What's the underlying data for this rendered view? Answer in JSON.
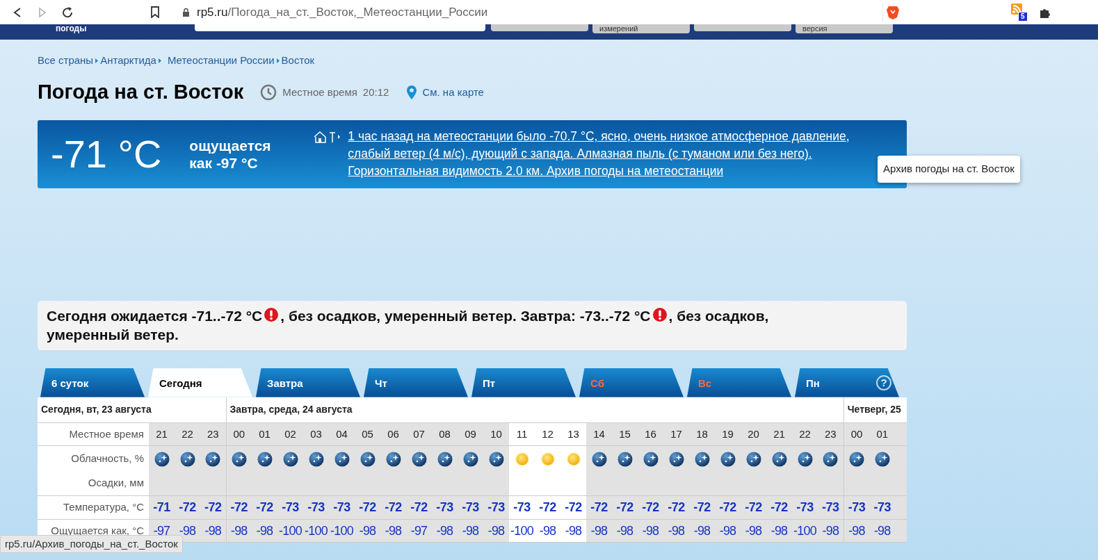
{
  "browser": {
    "url_host": "rp5.ru",
    "url_path": "/Погода_на_ст._Восток,_Метеостанции_России",
    "extension_badge": "5"
  },
  "site_header": {
    "logo_caption": "погоды",
    "buttons": [
      "измерений",
      "версия"
    ]
  },
  "breadcrumbs": [
    "Все страны",
    "Антарктида",
    "Метеостанции России",
    "Восток"
  ],
  "title": "Погода на ст. Восток",
  "local_time": {
    "label": "Местное время",
    "value": "20:12"
  },
  "map_link": "См. на карте",
  "current": {
    "temperature": "-71 °C",
    "feels_like": "ощущается как -97 °C",
    "description": "1 час назад на метеостанции было -70.7 °C, ясно, очень низкое атмосферное давление, слабый ветер (4 м/с), дующий с запада. Алмазная пыль (с туманом или без него). Горизонтальная видимость 2.0 км. Архив погоды на метеостанции",
    "tooltip": "Архив погоды на ст. Восток"
  },
  "forecast": [
    {
      "kind": "text",
      "text": "Сегодня ожидается -71..-72 °C"
    },
    {
      "kind": "alert"
    },
    {
      "kind": "text",
      "text": ", без осадков, умеренный ветер. Завтра: -73..-72 °C"
    },
    {
      "kind": "alert"
    },
    {
      "kind": "text",
      "text": ", без осадков, умеренный ветер."
    }
  ],
  "tabs": [
    {
      "label": "6 суток",
      "selected": false,
      "weekend": false
    },
    {
      "label": "Сегодня",
      "selected": true,
      "weekend": false
    },
    {
      "label": "Завтра",
      "selected": false,
      "weekend": false
    },
    {
      "label": "Чт",
      "selected": false,
      "weekend": false
    },
    {
      "label": "Пт",
      "selected": false,
      "weekend": false
    },
    {
      "label": "Сб",
      "selected": false,
      "weekend": true
    },
    {
      "label": "Вс",
      "selected": false,
      "weekend": true
    },
    {
      "label": "Пн",
      "selected": false,
      "weekend": false
    }
  ],
  "help_label": "?",
  "table": {
    "row_labels": [
      "Местное время",
      "Облачность, %",
      "Осадки, мм",
      "Температура, °C",
      "Ощущается как, °C"
    ],
    "days": [
      {
        "label": "Сегодня, вт, 23 августа",
        "hours": [
          {
            "time": "21",
            "kind": "night",
            "daylight": false,
            "temp": "-71",
            "feels": "-97"
          },
          {
            "time": "22",
            "kind": "night",
            "daylight": false,
            "temp": "-72",
            "feels": "-98"
          },
          {
            "time": "23",
            "kind": "night",
            "daylight": false,
            "temp": "-72",
            "feels": "-98"
          }
        ]
      },
      {
        "label": "Завтра, среда, 24 августа",
        "hours": [
          {
            "time": "00",
            "kind": "night",
            "daylight": false,
            "temp": "-72",
            "feels": "-98"
          },
          {
            "time": "01",
            "kind": "night",
            "daylight": false,
            "temp": "-72",
            "feels": "-98"
          },
          {
            "time": "02",
            "kind": "night",
            "daylight": false,
            "temp": "-73",
            "feels": "-100"
          },
          {
            "time": "03",
            "kind": "night",
            "daylight": false,
            "temp": "-73",
            "feels": "-100"
          },
          {
            "time": "04",
            "kind": "night",
            "daylight": false,
            "temp": "-73",
            "feels": "-100"
          },
          {
            "time": "05",
            "kind": "night",
            "daylight": false,
            "temp": "-72",
            "feels": "-98"
          },
          {
            "time": "06",
            "kind": "night",
            "daylight": false,
            "temp": "-72",
            "feels": "-98"
          },
          {
            "time": "07",
            "kind": "night",
            "daylight": false,
            "temp": "-72",
            "feels": "-97"
          },
          {
            "time": "08",
            "kind": "night",
            "daylight": false,
            "temp": "-73",
            "feels": "-98"
          },
          {
            "time": "09",
            "kind": "night",
            "daylight": false,
            "temp": "-73",
            "feels": "-98"
          },
          {
            "time": "10",
            "kind": "night",
            "daylight": false,
            "temp": "-73",
            "feels": "-98"
          },
          {
            "time": "11",
            "kind": "sun",
            "daylight": true,
            "temp": "-73",
            "feels": "-100"
          },
          {
            "time": "12",
            "kind": "sun",
            "daylight": true,
            "temp": "-72",
            "feels": "-98"
          },
          {
            "time": "13",
            "kind": "sun",
            "daylight": true,
            "temp": "-72",
            "feels": "-98"
          },
          {
            "time": "14",
            "kind": "night",
            "daylight": false,
            "temp": "-72",
            "feels": "-98"
          },
          {
            "time": "15",
            "kind": "night",
            "daylight": false,
            "temp": "-72",
            "feels": "-98"
          },
          {
            "time": "16",
            "kind": "night",
            "daylight": false,
            "temp": "-72",
            "feels": "-98"
          },
          {
            "time": "17",
            "kind": "night",
            "daylight": false,
            "temp": "-72",
            "feels": "-98"
          },
          {
            "time": "18",
            "kind": "night",
            "daylight": false,
            "temp": "-72",
            "feels": "-98"
          },
          {
            "time": "19",
            "kind": "night",
            "daylight": false,
            "temp": "-72",
            "feels": "-98"
          },
          {
            "time": "20",
            "kind": "night",
            "daylight": false,
            "temp": "-72",
            "feels": "-98"
          },
          {
            "time": "21",
            "kind": "night",
            "daylight": false,
            "temp": "-72",
            "feels": "-98"
          },
          {
            "time": "22",
            "kind": "night",
            "daylight": false,
            "temp": "-73",
            "feels": "-100"
          },
          {
            "time": "23",
            "kind": "night",
            "daylight": false,
            "temp": "-73",
            "feels": "-98"
          }
        ]
      },
      {
        "label": "Четверг, 25",
        "hours": [
          {
            "time": "00",
            "kind": "night",
            "daylight": false,
            "temp": "-73",
            "feels": "-98"
          },
          {
            "time": "01",
            "kind": "night",
            "daylight": false,
            "temp": "-73",
            "feels": "-98"
          }
        ]
      }
    ]
  },
  "status_bar": "rp5.ru/Архив_погоды_на_ст._Восток"
}
